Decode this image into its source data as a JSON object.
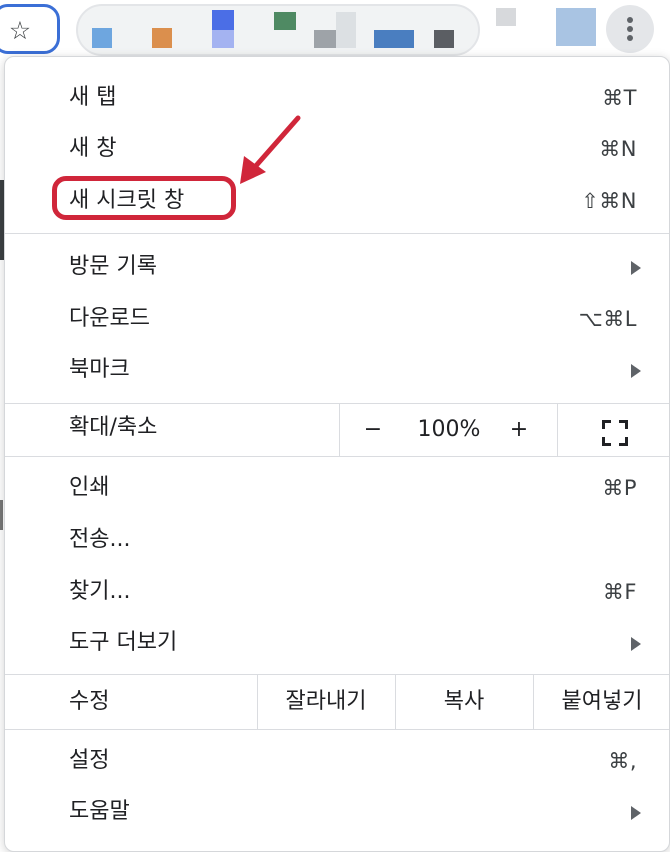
{
  "toolbar": {
    "bookmark_icon": "star-icon",
    "menu_icon": "three-dots-vertical-icon",
    "accent_color": "#3b6fd6"
  },
  "menu": {
    "new_tab": {
      "label": "새 탭",
      "shortcut": "⌘T"
    },
    "new_window": {
      "label": "새 창",
      "shortcut": "⌘N"
    },
    "new_incognito": {
      "label": "새 시크릿 창",
      "shortcut": "⇧⌘N"
    },
    "history": {
      "label": "방문 기록",
      "icon": "chevron-right-icon"
    },
    "downloads": {
      "label": "다운로드",
      "shortcut": "⌥⌘L"
    },
    "bookmarks": {
      "label": "북마크",
      "icon": "chevron-right-icon"
    },
    "zoom": {
      "label": "확대/축소",
      "minus": "−",
      "value": "100%",
      "plus": "+",
      "fullscreen_icon": "fullscreen-icon"
    },
    "print": {
      "label": "인쇄",
      "shortcut": "⌘P"
    },
    "cast": {
      "label": "전송..."
    },
    "find": {
      "label": "찾기...",
      "shortcut": "⌘F"
    },
    "more_tools": {
      "label": "도구 더보기",
      "icon": "chevron-right-icon"
    },
    "edit": {
      "label": "수정",
      "cut": "잘라내기",
      "copy": "복사",
      "paste": "붙여넣기"
    },
    "settings": {
      "label": "설정",
      "shortcut": "⌘,"
    },
    "help": {
      "label": "도움말",
      "icon": "chevron-right-icon"
    }
  },
  "annotation": {
    "highlight_color": "#d0263a"
  }
}
